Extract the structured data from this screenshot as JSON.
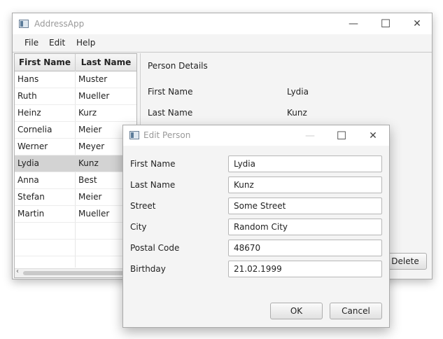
{
  "main_window": {
    "title": "AddressApp",
    "controls": {
      "minimize": "—",
      "maximize": "☐",
      "close": "✕"
    },
    "menu": [
      "File",
      "Edit",
      "Help"
    ],
    "table": {
      "headers": [
        "First Name",
        "Last Name"
      ],
      "rows": [
        [
          "Hans",
          "Muster"
        ],
        [
          "Ruth",
          "Mueller"
        ],
        [
          "Heinz",
          "Kurz"
        ],
        [
          "Cornelia",
          "Meier"
        ],
        [
          "Werner",
          "Meyer"
        ],
        [
          "Lydia",
          "Kunz"
        ],
        [
          "Anna",
          "Best"
        ],
        [
          "Stefan",
          "Meier"
        ],
        [
          "Martin",
          "Mueller"
        ]
      ],
      "selected_row": 5
    },
    "details": {
      "heading": "Person Details",
      "first_name_label": "First Name",
      "first_name_value": "Lydia",
      "last_name_label": "Last Name",
      "last_name_value": "Kunz",
      "delete_button": "Delete"
    }
  },
  "dialog": {
    "title": "Edit Person",
    "controls": {
      "minimize": "—",
      "maximize": "☐",
      "close": "✕"
    },
    "fields": [
      {
        "label": "First Name",
        "value": "Lydia"
      },
      {
        "label": "Last Name",
        "value": "Kunz"
      },
      {
        "label": "Street",
        "value": "Some Street"
      },
      {
        "label": "City",
        "value": "Random City"
      },
      {
        "label": "Postal Code",
        "value": "48670"
      },
      {
        "label": "Birthday",
        "value": "21.02.1999"
      }
    ],
    "ok_button": "OK",
    "cancel_button": "Cancel"
  }
}
